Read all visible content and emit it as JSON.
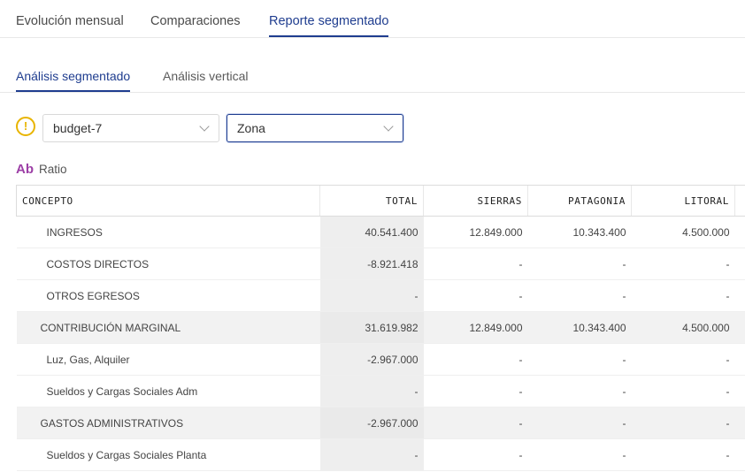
{
  "top_tabs": [
    {
      "label": "Evolución mensual"
    },
    {
      "label": "Comparaciones"
    },
    {
      "label": "Reporte segmentado"
    }
  ],
  "sub_tabs": [
    {
      "label": "Análisis segmentado"
    },
    {
      "label": "Análisis vertical"
    }
  ],
  "warning_icon": "!",
  "filters": {
    "budget": {
      "value": "budget-7"
    },
    "zone": {
      "value": "Zona"
    }
  },
  "ratio": {
    "icon": "Ab",
    "label": "Ratio"
  },
  "colors": {
    "accent": "#1f3d8f",
    "warning": "#e8b400",
    "ratio_icon": "#9c3fa6"
  },
  "table": {
    "headers": [
      "CONCEPTO",
      "TOTAL",
      "SIERRAS",
      "PATAGONIA",
      "LITORAL"
    ],
    "rows": [
      {
        "type": "sub",
        "cells": [
          "INGRESOS",
          "40.541.400",
          "12.849.000",
          "10.343.400",
          "4.500.000"
        ]
      },
      {
        "type": "sub",
        "cells": [
          "COSTOS DIRECTOS",
          "-8.921.418",
          "-",
          "-",
          "-"
        ]
      },
      {
        "type": "sub",
        "cells": [
          "OTROS EGRESOS",
          "-",
          "-",
          "-",
          "-"
        ]
      },
      {
        "type": "group",
        "cells": [
          "CONTRIBUCIÓN MARGINAL",
          "31.619.982",
          "12.849.000",
          "10.343.400",
          "4.500.000"
        ]
      },
      {
        "type": "sub",
        "cells": [
          "Luz, Gas, Alquiler",
          "-2.967.000",
          "-",
          "-",
          "-"
        ]
      },
      {
        "type": "sub",
        "cells": [
          "Sueldos y Cargas Sociales Adm",
          "-",
          "-",
          "-",
          "-"
        ]
      },
      {
        "type": "group",
        "cells": [
          "GASTOS ADMINISTRATIVOS",
          "-2.967.000",
          "-",
          "-",
          "-"
        ]
      },
      {
        "type": "sub",
        "cells": [
          "Sueldos y Cargas Sociales Planta",
          "-",
          "-",
          "-",
          "-"
        ]
      }
    ]
  }
}
